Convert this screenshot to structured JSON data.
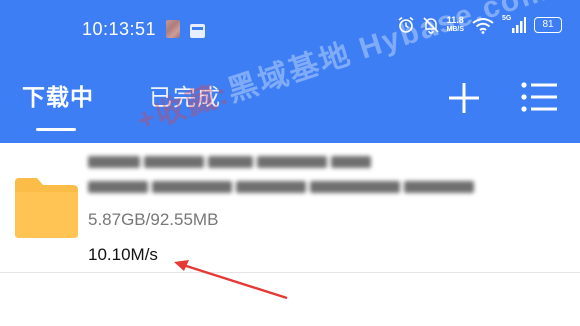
{
  "status_bar": {
    "time": "10:13:51",
    "net_speed_value": "11.8",
    "net_speed_unit": "MB/S",
    "signal_label": "5G",
    "battery": "81"
  },
  "tabs": [
    {
      "label": "下载中",
      "active": true
    },
    {
      "label": "已完成",
      "active": false
    }
  ],
  "toolbar": {
    "add_icon": "plus-icon",
    "menu_icon": "list-menu-icon"
  },
  "watermark": {
    "prefix": "+收藏:",
    "text": "黑域基地 Hybase.com"
  },
  "download_item": {
    "icon": "folder-icon",
    "size_text": "5.87GB/92.55MB",
    "speed_text": "10.10M/s",
    "name_blurred": true
  },
  "colors": {
    "accent": "#3d7ef5",
    "folder": "#fbbd48",
    "annotation_arrow": "#e53935"
  }
}
